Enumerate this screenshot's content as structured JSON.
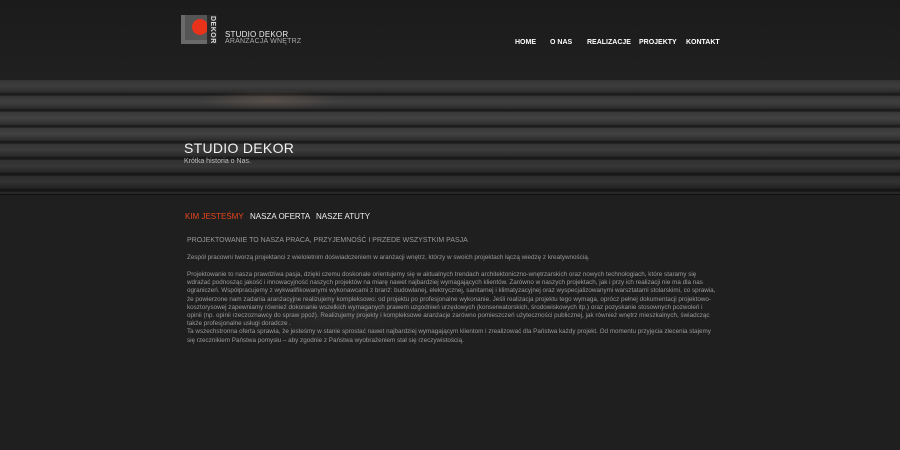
{
  "header": {
    "logo_letters": "DEKOR",
    "brand_name": "STUDIO DEKOR",
    "brand_tagline": "ARANŻACJA WNĘTRZ",
    "nav": [
      {
        "label": "HOME"
      },
      {
        "label": "O NAS"
      },
      {
        "label": "REALIZACJE"
      },
      {
        "label": "PROJEKTY"
      },
      {
        "label": "KONTAKT"
      }
    ]
  },
  "banner": {
    "title": "STUDIO DEKOR",
    "subtitle": "Krótka historia o Nas."
  },
  "content": {
    "tabs": [
      {
        "label": "KIM JESTEŚMY",
        "active": true
      },
      {
        "label": "NASZA OFERTA",
        "active": false
      },
      {
        "label": "NASZE ATUTY",
        "active": false
      }
    ],
    "heading": "PROJEKTOWANIE TO NASZA PRACA, PRZYJEMNOŚĆ I PRZEDE WSZYSTKIM PASJA",
    "paragraph1": "Zespół pracowni tworzą projektanci z wieloletnim doświadczeniem w aranżacji wnętrz, którzy w swoich projektach łączą wiedzę z kreatywnością.",
    "paragraph2": "Projektowanie to nasza prawdziwa pasja, dzięki czemu doskonale orientujemy się w aktualnych trendach architektoniczno-wnętrzarskich oraz nowych technologiach, które staramy się wdrażać podnosząc jakość i innowacyjność naszych projektów na miarę nawet najbardziej wymagających klientów. Zarówno w naszych projektach, jak i przy ich realizacji nie ma dla nas ograniczeń. Współpracujemy z wykwalifikowanymi wykonawcami z branż: budowlanej, elektrycznej, sanitarnej i klimatyzacyjnej oraz wyspecjalizowanymi warsztatami stolarskimi, co sprawia, że powierzone nam zadania aranżacyjne realizujemy kompleksowo: od projektu po profesjonalne wykonanie. Jeśli realizacja projektu tego wymaga, oprócz pełnej dokumentacji projektowo-kosztorysowej zapewniamy również dokonanie wszelkich wymaganych prawem uzgodnień urzędowych (konserwatorskich, środowiskowych itp.) oraz pozyskanie stosownych pozwoleń i opinii (np. opinii rzeczoznawcy do spraw ppoż). Realizujemy projekty i kompleksowe aranżacje zarówno pomieszczeń użyteczności publicznej, jak również wnętrz mieszkalnych, świadcząc także profesjonalne usługi doradcze .",
    "paragraph3": "Ta wszechstronna oferta sprawia, że jesteśmy w stanie sprostać nawet najbardziej wymagającym klientom i zrealizować dla Państwa każdy projekt. Od momentu przyjęcia zlecenia stajemy się rzecznikiem Państwa pomysłu – aby zgodnie z Państwa wyobrażeniem stał się rzeczywistością.",
    "colors": {
      "accent": "#e8461d",
      "text": "#9a9a9a",
      "background": "#1f1f1f"
    }
  }
}
